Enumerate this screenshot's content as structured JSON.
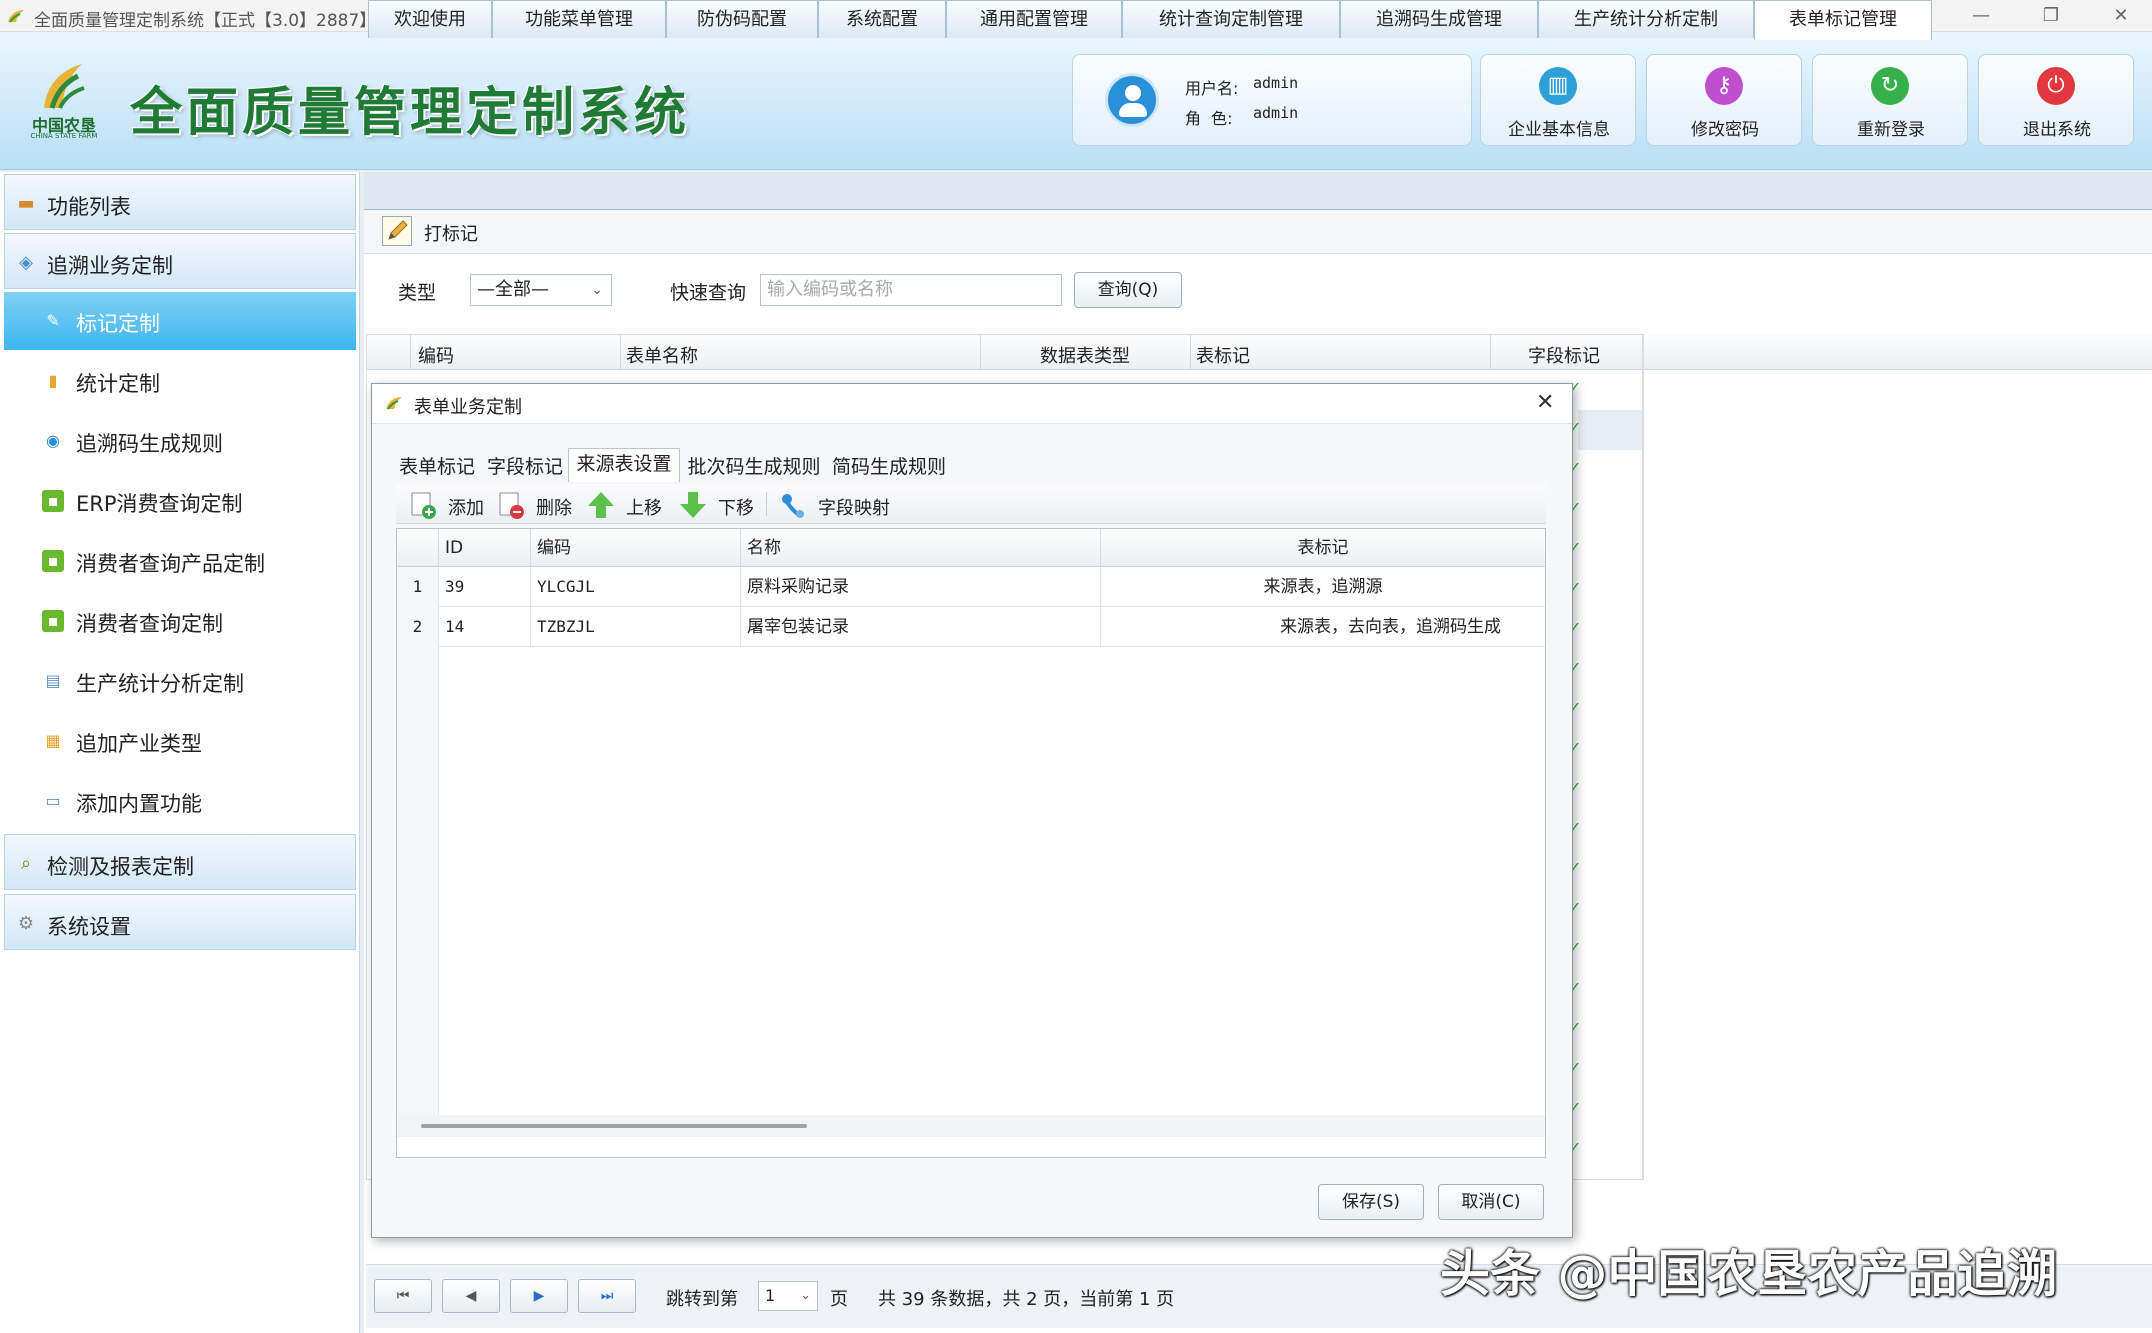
{
  "window": {
    "title": "全面质量管理定制系统【正式【3.0】2887】",
    "controls": [
      "—",
      "❐",
      "✕"
    ]
  },
  "header": {
    "logo_cn": "中国农垦",
    "logo_en": "CHINA STATE FARM",
    "app_title": "全面质量管理定制系统",
    "user_label": "用户名:",
    "user_value": "admin",
    "role_label": "角  色:",
    "role_value": "admin",
    "buttons": [
      {
        "label": "企业基本信息",
        "icon": "building-icon",
        "color": "#2f9fd8"
      },
      {
        "label": "修改密码",
        "icon": "key-icon",
        "color": "#c04fd0"
      },
      {
        "label": "重新登录",
        "icon": "refresh-icon",
        "color": "#35b04a"
      },
      {
        "label": "退出系统",
        "icon": "power-icon",
        "color": "#e0383e"
      }
    ]
  },
  "sidebar": {
    "groups": [
      {
        "label": "功能列表",
        "icon": "folder-icon"
      },
      {
        "label": "追溯业务定制",
        "icon": "trace-icon"
      },
      {
        "label": "检测及报表定制",
        "icon": "search-icon"
      },
      {
        "label": "系统设置",
        "icon": "gear-icon"
      }
    ],
    "items": [
      {
        "label": "标记定制",
        "icon": "mark-icon",
        "active": true
      },
      {
        "label": "统计定制",
        "icon": "bar-chart-icon"
      },
      {
        "label": "追溯码生成规则",
        "icon": "spiral-icon"
      },
      {
        "label": "ERP消费查询定制",
        "icon": "message-icon"
      },
      {
        "label": "消费者查询产品定制",
        "icon": "message-icon"
      },
      {
        "label": "消费者查询定制",
        "icon": "message-icon"
      },
      {
        "label": "生产统计分析定制",
        "icon": "table-icon"
      },
      {
        "label": "追加产业类型",
        "icon": "add-type-icon"
      },
      {
        "label": "添加内置功能",
        "icon": "window-icon"
      }
    ]
  },
  "main_tabs": [
    "欢迎使用",
    "功能菜单管理",
    "防伪码配置",
    "系统配置",
    "通用配置管理",
    "统计查询定制管理",
    "追溯码生成管理",
    "生产统计分析定制",
    "表单标记管理"
  ],
  "active_main_tab": "表单标记管理",
  "toolbar": {
    "mark_button": "打标记"
  },
  "filter": {
    "type_label": "类型",
    "type_value": "—全部—",
    "quick_label": "快速查询",
    "quick_placeholder": "输入编码或名称",
    "query_button": "查询(Q)"
  },
  "bg_table": {
    "headers": [
      "编码",
      "表单名称",
      "数据表类型",
      "表标记",
      "字段标记"
    ],
    "check": "✓"
  },
  "dialog": {
    "title": "表单业务定制",
    "close": "✕",
    "tabs": [
      "表单标记",
      "字段标记",
      "来源表设置",
      "批次码生成规则",
      "简码生成规则"
    ],
    "active_tab": "来源表设置",
    "toolbar": [
      {
        "label": "添加",
        "icon": "add-icon"
      },
      {
        "label": "删除",
        "icon": "delete-icon"
      },
      {
        "label": "上移",
        "icon": "arrow-up-icon"
      },
      {
        "label": "下移",
        "icon": "arrow-down-icon"
      },
      {
        "label": "字段映射",
        "icon": "field-map-icon"
      }
    ],
    "grid": {
      "headers": [
        "ID",
        "编码",
        "名称",
        "表标记"
      ],
      "rows": [
        {
          "num": "1",
          "id": "39",
          "code": "YLCGJL",
          "name": "原料采购记录",
          "mark": "来源表，追溯源"
        },
        {
          "num": "2",
          "id": "14",
          "code": "TZBZJL",
          "name": "屠宰包装记录",
          "mark": "来源表，去向表，追溯码生成"
        }
      ]
    },
    "save_button": "保存(S)",
    "cancel_button": "取消(C)"
  },
  "pager": {
    "first": "⏮",
    "prev": "◀",
    "next": "▶",
    "last": "⏭",
    "jump_label": "跳转到第",
    "page_value": "1",
    "page_unit": "页",
    "summary": "共 39 条数据，共 2 页，当前第 1 页"
  },
  "watermark": "头条 @中国农垦农产品追溯"
}
